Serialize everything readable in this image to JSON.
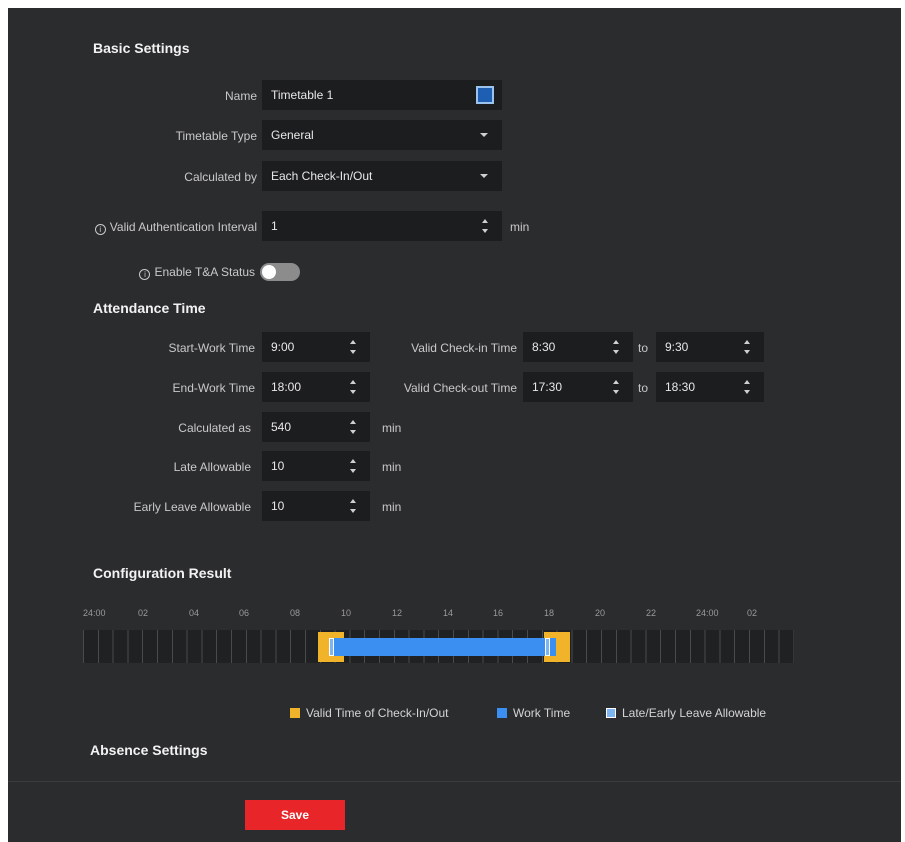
{
  "basic": {
    "title": "Basic Settings",
    "name_label": "Name",
    "name_value": "Timetable 1",
    "type_label": "Timetable Type",
    "type_value": "General",
    "calc_by_label": "Calculated by",
    "calc_by_value": "Each Check-In/Out",
    "interval_label": "Valid Authentication Interval",
    "interval_value": "1",
    "interval_unit": "min",
    "ta_status_label": "Enable T&A Status",
    "ta_status_on": false,
    "color": "#1e5fb4"
  },
  "attendance": {
    "title": "Attendance Time",
    "start_label": "Start-Work Time",
    "start_value": "9:00",
    "end_label": "End-Work Time",
    "end_value": "18:00",
    "calc_as_label": "Calculated as",
    "calc_as_value": "540",
    "calc_as_unit": "min",
    "late_label": "Late Allowable",
    "late_value": "10",
    "late_unit": "min",
    "early_label": "Early Leave Allowable",
    "early_value": "10",
    "early_unit": "min",
    "checkin_label": "Valid Check-in Time",
    "checkin_from": "8:30",
    "checkin_to": "9:30",
    "checkout_label": "Valid Check-out Time",
    "checkout_from": "17:30",
    "checkout_to": "18:30",
    "to_label": "to"
  },
  "config": {
    "title": "Configuration Result",
    "ticks": [
      "24:00",
      "02",
      "04",
      "06",
      "08",
      "10",
      "12",
      "14",
      "16",
      "18",
      "20",
      "22",
      "24:00",
      "02"
    ],
    "legend": {
      "valid": "Valid Time of Check-In/Out",
      "work": "Work Time",
      "late": "Late/Early Leave Allowable"
    },
    "colors": {
      "valid": "#f0b32a",
      "work": "#3b8ff0",
      "late": "#7db5f3"
    }
  },
  "absence": {
    "title": "Absence Settings"
  },
  "footer": {
    "save_label": "Save",
    "save_color": "#e8262a"
  }
}
